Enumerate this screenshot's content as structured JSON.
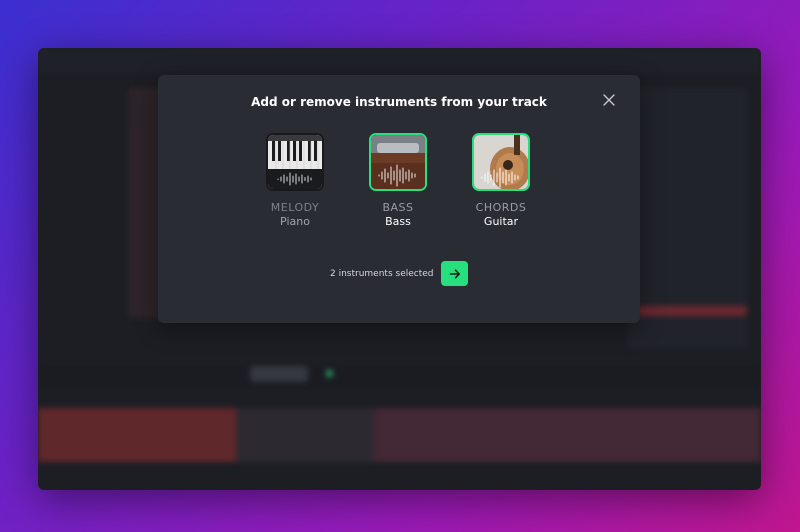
{
  "dialog": {
    "title": "Add or remove instruments from your track",
    "status": "2 instruments selected"
  },
  "instruments": [
    {
      "category": "MELODY",
      "name": "Piano",
      "selected": false
    },
    {
      "category": "BASS",
      "name": "Bass",
      "selected": true
    },
    {
      "category": "CHORDS",
      "name": "Guitar",
      "selected": true
    }
  ],
  "colors": {
    "accent": "#27e07d",
    "modal_bg": "#2a2c33",
    "app_bg": "#1c1e24"
  },
  "icons": {
    "close": "close-icon",
    "next": "arrow-right-icon"
  }
}
